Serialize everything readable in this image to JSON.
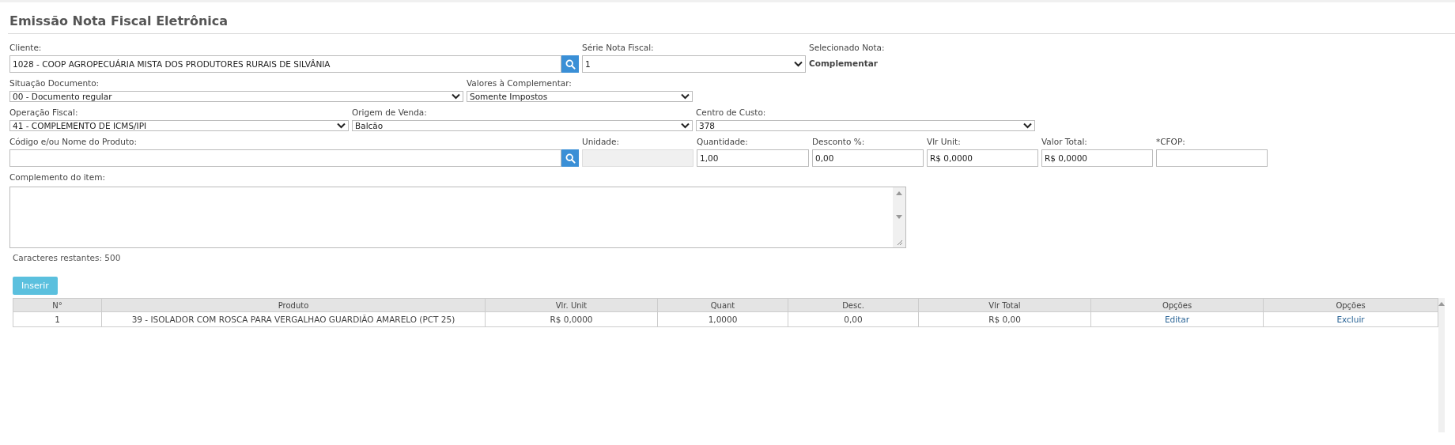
{
  "title": "Emissão Nota Fiscal Eletrônica",
  "form_rows": [
    {
      "fields": [
        {
          "kind": "search",
          "label": "Cliente:",
          "value": "1028 - COOP AGROPECUÁRIA MISTA DOS PRODUTORES RURAIS DE SILVÂNIA"
        },
        {
          "kind": "select",
          "label": "Série Nota Fiscal:",
          "value": "1"
        },
        {
          "kind": "info",
          "label": "Selecionado Nota:",
          "value": "Complementar"
        }
      ]
    },
    {
      "fields": [
        {
          "kind": "select",
          "label": "Situação Documento:",
          "value": "00 - Documento regular"
        },
        {
          "kind": "select",
          "label": "Valores à Complementar:",
          "value": "Somente Impostos"
        }
      ]
    },
    {
      "fields": [
        {
          "kind": "select",
          "label": "Operação Fiscal:",
          "value": "41 - COMPLEMENTO DE ICMS/IPI"
        },
        {
          "kind": "select",
          "label": "Origem de Venda:",
          "value": "Balcão"
        },
        {
          "kind": "select",
          "label": "Centro de Custo:",
          "value": "378"
        }
      ]
    },
    {
      "fields": [
        {
          "kind": "search",
          "label": "Código e/ou Nome do Produto:"
        },
        {
          "kind": "readonly",
          "label": "Unidade:"
        },
        {
          "kind": "text",
          "label": "Quantidade:",
          "value": "1,00"
        },
        {
          "kind": "text",
          "label": "Desconto %:",
          "value": "0,00"
        },
        {
          "kind": "text",
          "label": "Vlr Unit:",
          "value": "R$ 0,0000"
        },
        {
          "kind": "text",
          "label": "Valor Total:",
          "value": "R$ 0,0000"
        },
        {
          "kind": "text",
          "label": "*CFOP:"
        }
      ]
    }
  ],
  "complemento": {
    "label": "Complemento do item:",
    "counter": "Caracteres restantes: 500"
  },
  "insert_button": "Inserir",
  "table": {
    "columns": [
      "N°",
      "Produto",
      "Vlr. Unit",
      "Quant",
      "Desc.",
      "Vlr Total",
      "Opções",
      "Opções"
    ],
    "rows": [
      {
        "cells": [
          "1",
          "39 - ISOLADOR COM ROSCA PARA VERGALHAO GUARDIÃO AMARELO (PCT 25)",
          "R$ 0,0000",
          "1,0000",
          "0,00",
          "R$ 0,00"
        ],
        "links": [
          "Editar",
          "Excluir"
        ]
      }
    ]
  }
}
